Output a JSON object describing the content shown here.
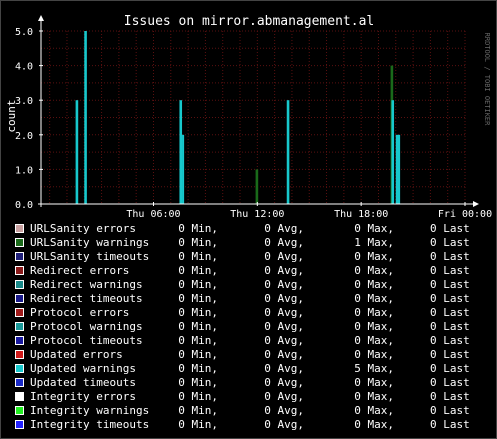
{
  "title": "Issues on mirror.abmanagement.al",
  "ylabel": "count",
  "watermark": "RRDTOOL / TOBI OETIKER",
  "colors": {
    "background": "#000000",
    "canvas": "#000000",
    "grid": "#5a1010",
    "axis": "#ffffff",
    "text": "#ffffff",
    "series_cyan": "#17c8cc",
    "series_green": "#0e6a0e",
    "series_line": "#3d6bff"
  },
  "chart_data": {
    "type": "area",
    "title": "Issues on mirror.abmanagement.al",
    "xlabel": "",
    "ylabel": "count",
    "ylim": [
      0,
      5
    ],
    "yticks": [
      "0.0",
      "1.0",
      "2.0",
      "3.0",
      "4.0",
      "5.0"
    ],
    "xticks": [
      {
        "label": "Thu 06:00",
        "t": 6
      },
      {
        "label": "Thu 12:00",
        "t": 12
      },
      {
        "label": "Thu 18:00",
        "t": 18
      },
      {
        "label": "Fri 00:00",
        "t": 24
      }
    ],
    "xrange": [
      -0.5,
      24
    ],
    "grid": true,
    "spikes": [
      {
        "series": "Updated warnings",
        "t": 1.5,
        "value": 3,
        "width": 0.15
      },
      {
        "series": "Updated warnings",
        "t": 2.0,
        "value": 5,
        "width": 0.15
      },
      {
        "series": "Updated warnings",
        "t": 7.5,
        "value": 3,
        "width": 0.15
      },
      {
        "series": "Updated warnings",
        "t": 7.65,
        "value": 2,
        "width": 0.12
      },
      {
        "series": "URLSanity warnings",
        "t": 11.9,
        "value": 1,
        "width": 0.15
      },
      {
        "series": "Updated warnings",
        "t": 13.7,
        "value": 3,
        "width": 0.15
      },
      {
        "series": "URLSanity warnings",
        "t": 19.7,
        "value": 4,
        "width": 0.15
      },
      {
        "series": "Updated warnings",
        "t": 19.75,
        "value": 3,
        "width": 0.15
      },
      {
        "series": "Updated warnings",
        "t": 20.0,
        "value": 2,
        "width": 0.25
      }
    ],
    "series": [
      {
        "name": "URLSanity errors",
        "color": "#c8a0a0",
        "min": "0 Min,",
        "avg": "0 Avg,",
        "max": "0 Max,",
        "last": "0 Last"
      },
      {
        "name": "URLSanity warnings",
        "color": "#1a6a1a",
        "min": "0 Min,",
        "avg": "0 Avg,",
        "max": "1 Max,",
        "last": "0 Last"
      },
      {
        "name": "URLSanity timeouts",
        "color": "#20207a",
        "min": "0 Min,",
        "avg": "0 Avg,",
        "max": "0 Max,",
        "last": "0 Last"
      },
      {
        "name": "Redirect errors",
        "color": "#8a1a1a",
        "min": "0 Min,",
        "avg": "0 Avg,",
        "max": "0 Max,",
        "last": "0 Last"
      },
      {
        "name": "Redirect warnings",
        "color": "#1a8a8a",
        "min": "0 Min,",
        "avg": "0 Avg,",
        "max": "0 Max,",
        "last": "0 Last"
      },
      {
        "name": "Redirect timeouts",
        "color": "#1a1a8a",
        "min": "0 Min,",
        "avg": "0 Avg,",
        "max": "0 Max,",
        "last": "0 Last"
      },
      {
        "name": "Protocol errors",
        "color": "#a01a1a",
        "min": "0 Min,",
        "avg": "0 Avg,",
        "max": "0 Max,",
        "last": "0 Last"
      },
      {
        "name": "Protocol warnings",
        "color": "#1a9a9a",
        "min": "0 Min,",
        "avg": "0 Avg,",
        "max": "0 Max,",
        "last": "0 Last"
      },
      {
        "name": "Protocol timeouts",
        "color": "#1a1aa0",
        "min": "0 Min,",
        "avg": "0 Avg,",
        "max": "0 Max,",
        "last": "0 Last"
      },
      {
        "name": "Updated errors",
        "color": "#d01a1a",
        "min": "0 Min,",
        "avg": "0 Avg,",
        "max": "0 Max,",
        "last": "0 Last"
      },
      {
        "name": "Updated warnings",
        "color": "#17c8cc",
        "min": "0 Min,",
        "avg": "0 Avg,",
        "max": "5 Max,",
        "last": "0 Last"
      },
      {
        "name": "Updated timeouts",
        "color": "#1a2ac8",
        "min": "0 Min,",
        "avg": "0 Avg,",
        "max": "0 Max,",
        "last": "0 Last"
      },
      {
        "name": "Integrity errors",
        "color": "#ffffff",
        "min": "0 Min,",
        "avg": "0 Avg,",
        "max": "0 Max,",
        "last": "0 Last"
      },
      {
        "name": "Integrity warnings",
        "color": "#22ee22",
        "min": "0 Min,",
        "avg": "0 Avg,",
        "max": "0 Max,",
        "last": "0 Last"
      },
      {
        "name": "Integrity timeouts",
        "color": "#2222ff",
        "min": "0 Min,",
        "avg": "0 Avg,",
        "max": "0 Max,",
        "last": "0 Last"
      }
    ]
  }
}
